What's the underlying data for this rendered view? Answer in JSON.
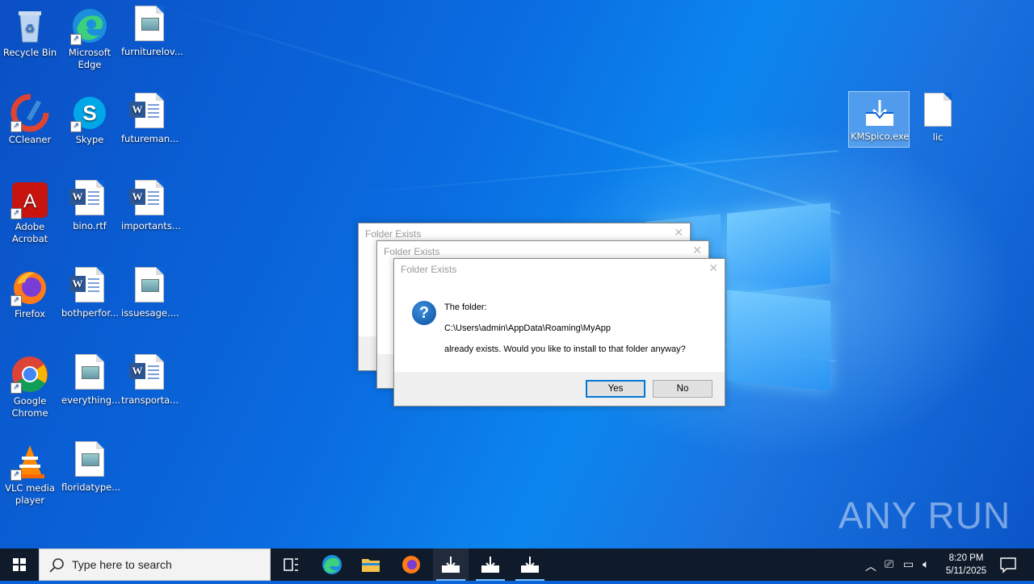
{
  "desktop": {
    "icons": [
      {
        "label": "Recycle Bin"
      },
      {
        "label": "Microsoft Edge"
      },
      {
        "label": "furniturelov..."
      },
      {
        "label": "CCleaner"
      },
      {
        "label": "Skype"
      },
      {
        "label": "futureman..."
      },
      {
        "label": "Adobe Acrobat"
      },
      {
        "label": "bino.rtf"
      },
      {
        "label": "importants..."
      },
      {
        "label": "Firefox"
      },
      {
        "label": "bothperfor..."
      },
      {
        "label": "issuesage...."
      },
      {
        "label": "Google Chrome"
      },
      {
        "label": "everything..."
      },
      {
        "label": "transporta..."
      },
      {
        "label": "VLC media player"
      },
      {
        "label": "floridatype..."
      },
      {
        "label": "KMSpico.exe"
      },
      {
        "label": "lic"
      }
    ],
    "watermark": "ANY RUN"
  },
  "dialogs": [
    {
      "title": "Folder Exists"
    },
    {
      "title": "Folder Exists"
    },
    {
      "title": "Folder Exists",
      "line1": "The folder:",
      "path": "C:\\Users\\admin\\AppData\\Roaming\\MyApp",
      "line3": "already exists. Would you like to install to that folder anyway?",
      "yes_label": "Yes",
      "no_label": "No"
    }
  ],
  "taskbar": {
    "search_placeholder": "Type here to search",
    "time": "8:20 PM",
    "date": "5/11/2025"
  }
}
